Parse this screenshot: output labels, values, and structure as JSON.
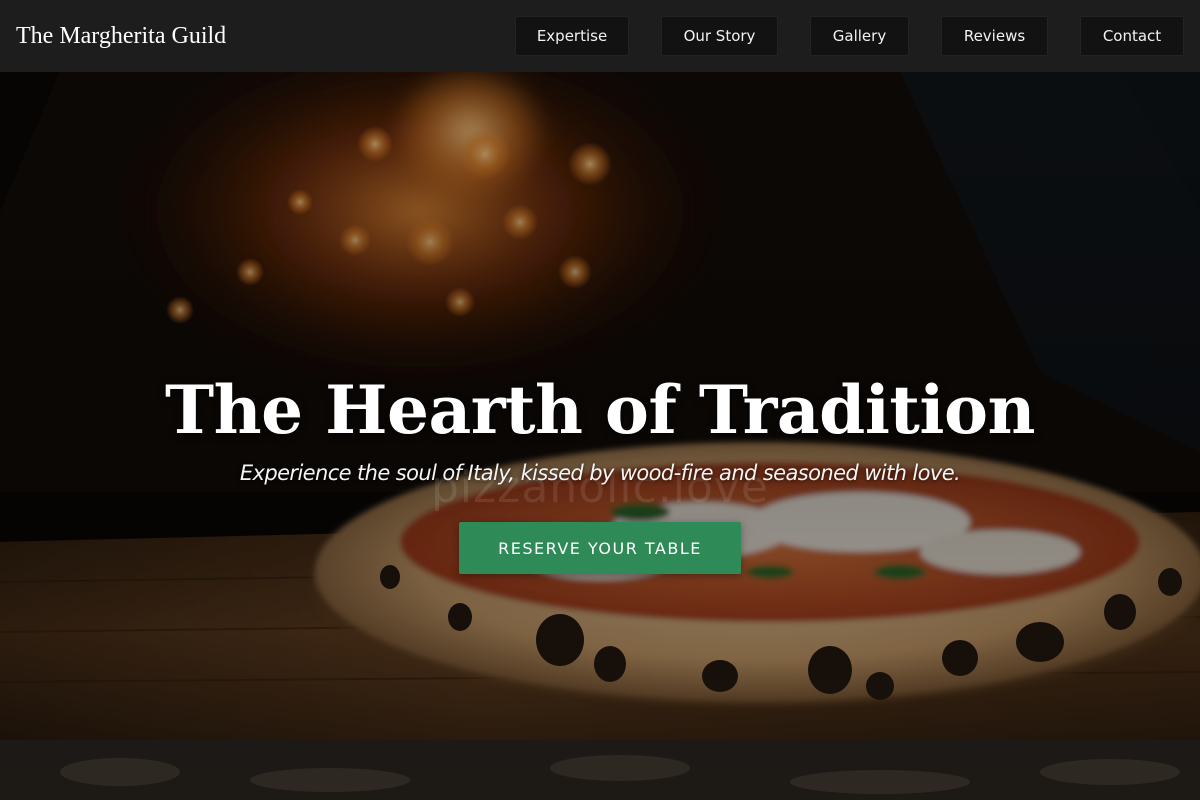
{
  "header": {
    "brand": "The Margherita Guild",
    "nav": [
      {
        "label": "Expertise"
      },
      {
        "label": "Our Story"
      },
      {
        "label": "Gallery"
      },
      {
        "label": "Reviews"
      },
      {
        "label": "Contact"
      }
    ]
  },
  "hero": {
    "title": "The Hearth of Tradition",
    "tagline": "Experience the soul of Italy, kissed by wood-fire and seasoned with love.",
    "cta_label": "RESERVE YOUR TABLE",
    "watermark": "pizzaholic.love",
    "image": "wood-fired-oven-margherita-pizza-photo"
  },
  "colors": {
    "header_bg": "#1d1d1d",
    "nav_button_bg": "#121212",
    "cta_bg": "#2e8b57",
    "text": "#ffffff"
  }
}
